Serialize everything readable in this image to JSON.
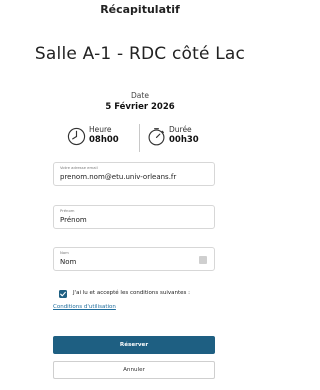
{
  "header": {
    "title": "Récapitulatif"
  },
  "room": {
    "name": "Salle A-1 - RDC côté Lac"
  },
  "date": {
    "label": "Date",
    "value": "5 Février 2026"
  },
  "time": {
    "label": "Heure",
    "value": "08h00"
  },
  "duration": {
    "label": "Durée",
    "value": "00h30"
  },
  "form": {
    "email": {
      "label": "Votre adresse email",
      "value": "prenom.nom@etu.univ-orleans.fr"
    },
    "first_name": {
      "label": "Prénom",
      "value": "Prénom"
    },
    "last_name": {
      "label": "Nom",
      "value": "Nom"
    }
  },
  "consent": {
    "text": "J'ai lu et accepté les conditions suivantes :",
    "checked": true,
    "link": "Conditions d'utilisation"
  },
  "actions": {
    "submit": "Réserver",
    "cancel": "Annuler"
  },
  "colors": {
    "primary": "#1e5f82",
    "link": "#1e6c9c"
  },
  "icons": {
    "time": "clock-icon",
    "duration": "timer-icon",
    "checkbox": "check-icon"
  }
}
